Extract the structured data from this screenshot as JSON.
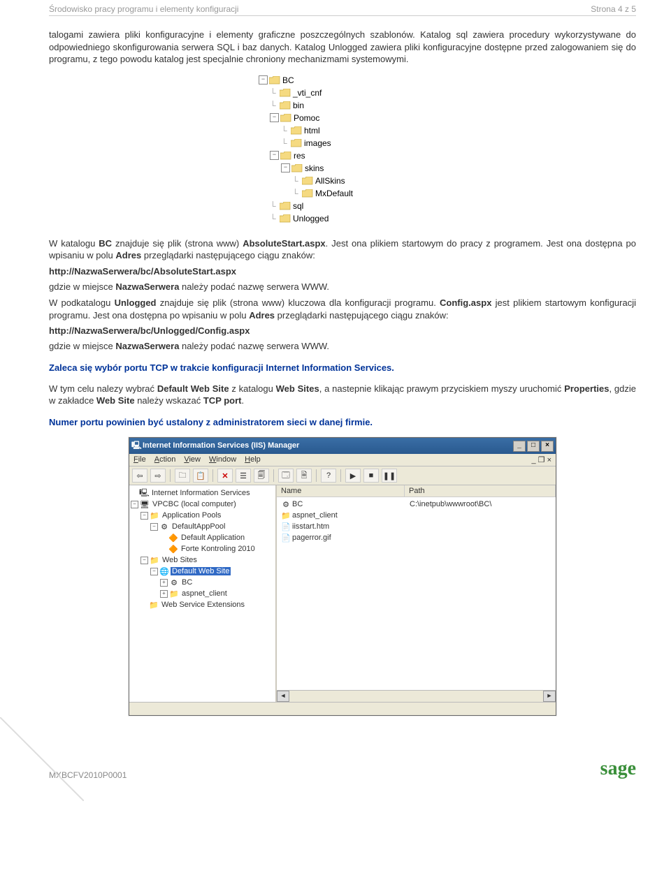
{
  "header": {
    "title": "Środowisko pracy programu i elementy konfiguracji",
    "page_info": "Strona 4 z 5"
  },
  "para1": "talogami zawiera pliki konfiguracyjne i elementy graficzne poszczególnych szablonów. Katalog sql zawiera procedury wykorzystywane do odpowiedniego skonfigurowania serwera SQL i baz danych. Katalog Unlogged zawiera pliki konfiguracyjne dostępne przed zalogowaniem się do programu, z tego powodu katalog jest specjalnie chroniony mechanizmami systemowymi.",
  "folder_tree": [
    {
      "indent": 0,
      "pm": "-",
      "label": "BC"
    },
    {
      "indent": 1,
      "tick": true,
      "label": "_vti_cnf"
    },
    {
      "indent": 1,
      "tick": true,
      "label": "bin"
    },
    {
      "indent": 1,
      "pm": "-",
      "label": "Pomoc"
    },
    {
      "indent": 2,
      "tick": true,
      "label": "html"
    },
    {
      "indent": 2,
      "tick": true,
      "label": "images"
    },
    {
      "indent": 1,
      "pm": "-",
      "label": "res"
    },
    {
      "indent": 2,
      "pm": "-",
      "label": "skins"
    },
    {
      "indent": 3,
      "tick": true,
      "label": "AllSkins"
    },
    {
      "indent": 3,
      "tick": true,
      "label": "MxDefault"
    },
    {
      "indent": 1,
      "tick": true,
      "label": "sql"
    },
    {
      "indent": 1,
      "tick": true,
      "label": "Unlogged"
    }
  ],
  "para2_parts": {
    "t1": "W katalogu ",
    "b1": "BC",
    "t2": " znajduje się plik (strona www) ",
    "b2": "AbsoluteStart.aspx",
    "t3": ". Jest ona plikiem startowym do pracy z programem. Jest ona dostępna po wpisaniu w polu ",
    "b3": "Adres",
    "t4": " przeglądarki następującego ciągu znaków:"
  },
  "url1": "http://NazwaSerwera/bc/AbsoluteStart.aspx",
  "para3_parts": {
    "t1": "gdzie w miejsce ",
    "b1": "NazwaSerwera",
    "t2": " należy podać nazwę serwera WWW."
  },
  "para4_parts": {
    "t1": "W podkatalogu ",
    "b1": "Unlogged",
    "t2": " znajduje się plik (strona www) kluczowa dla konfiguracji programu. ",
    "b2": "Config.aspx",
    "t3": " jest plikiem startowym konfiguracji programu. Jest ona dostępna po wpisaniu w polu ",
    "b3": "Adres",
    "t4": " przeglądarki następującego ciągu znaków:"
  },
  "url2": "http://NazwaSerwera/bc/Unlogged/Config.aspx",
  "para5_parts": {
    "t1": "gdzie w miejsce ",
    "b1": "NazwaSerwera",
    "t2": " należy podać nazwę serwera WWW."
  },
  "blue1": "Zaleca się wybór portu TCP w trakcie konfiguracji Internet Information Services.",
  "para6_parts": {
    "t1": "W tym celu nalezy wybrać ",
    "b1": "Default Web Site",
    "t2": " z katalogu ",
    "b2": "Web Sites",
    "t3": ", a nastepnie klikając prawym przyciskiem myszy uruchomić ",
    "b3": "Properties",
    "t4": ", gdzie w zakładce ",
    "b4": "Web Site",
    "t5": " należy wskazać ",
    "b5": "TCP port",
    "t6": "."
  },
  "blue2": "Numer portu powinien być ustalony z administratorem sieci w danej firmie.",
  "iis": {
    "title": "Internet Information Services (IIS) Manager",
    "menus": [
      "File",
      "Action",
      "View",
      "Window",
      "Help"
    ],
    "columns": {
      "name": "Name",
      "path": "Path"
    },
    "left_tree": [
      {
        "indent": 0,
        "label": "Internet Information Services",
        "icon": "🖳"
      },
      {
        "indent": 0,
        "pm": "-",
        "label": "VPCBC (local computer)",
        "icon": "🖥"
      },
      {
        "indent": 1,
        "pm": "-",
        "label": "Application Pools",
        "icon": "📁"
      },
      {
        "indent": 2,
        "pm": "-",
        "label": "DefaultAppPool",
        "icon": "⚙"
      },
      {
        "indent": 3,
        "label": "Default Application",
        "icon": "🔶"
      },
      {
        "indent": 3,
        "label": "Forte Kontroling 2010",
        "icon": "🔶"
      },
      {
        "indent": 1,
        "pm": "-",
        "label": "Web Sites",
        "icon": "📁"
      },
      {
        "indent": 2,
        "pm": "-",
        "label": "Default Web Site",
        "icon": "🌐",
        "selected": true
      },
      {
        "indent": 3,
        "pm": "+",
        "label": "BC",
        "icon": "⚙"
      },
      {
        "indent": 3,
        "pm": "+",
        "label": "aspnet_client",
        "icon": "📁"
      },
      {
        "indent": 1,
        "label": "Web Service Extensions",
        "icon": "📁"
      }
    ],
    "files": [
      {
        "name": "BC",
        "path": "C:\\inetpub\\wwwroot\\BC\\",
        "icon": "⚙"
      },
      {
        "name": "aspnet_client",
        "path": "",
        "icon": "📁"
      },
      {
        "name": "iisstart.htm",
        "path": "",
        "icon": "📄"
      },
      {
        "name": "pagerror.gif",
        "path": "",
        "icon": "📄"
      }
    ]
  },
  "footer": {
    "docid": "MXBCFV2010P0001",
    "logo": "sage"
  }
}
